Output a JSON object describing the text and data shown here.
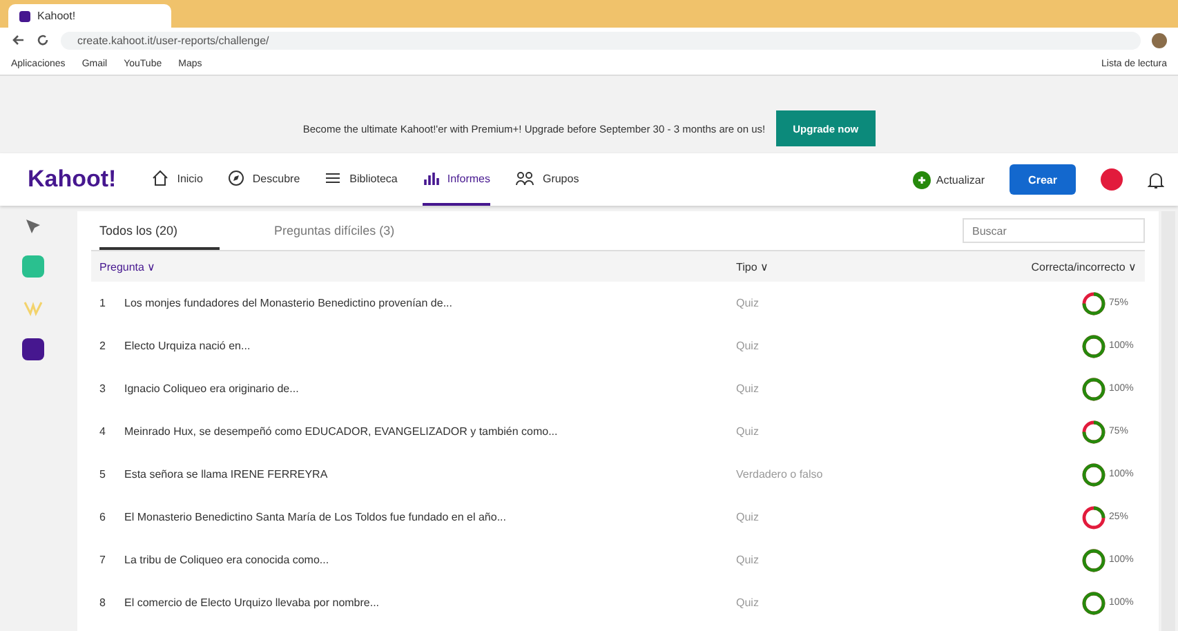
{
  "browser": {
    "tab_title": "Kahoot!",
    "url": "create.kahoot.it/user-reports/challenge/",
    "bookmarks": [
      "Aplicaciones",
      "Gmail",
      "YouTube",
      "Maps"
    ],
    "reading_list": "Lista de lectura"
  },
  "banner": {
    "text": "Become the ultimate Kahoot!'er with Premium+! Upgrade before September 30 - 3 months are on us!",
    "button": "Upgrade now"
  },
  "nav": {
    "logo": "Kahoot!",
    "items": [
      {
        "label": "Inicio",
        "selected": false
      },
      {
        "label": "Descubre",
        "selected": false
      },
      {
        "label": "Biblioteca",
        "selected": false
      },
      {
        "label": "Informes",
        "selected": true
      },
      {
        "label": "Grupos",
        "selected": false
      }
    ],
    "upgrade": "Actualizar",
    "create": "Crear"
  },
  "tabs": [
    {
      "label": "Todos los (20)",
      "selected": true
    },
    {
      "label": "Preguntas difíciles (3)",
      "selected": false
    }
  ],
  "search": {
    "placeholder": "Buscar"
  },
  "table": {
    "columns": [
      "Pregunta ∨",
      "Tipo ∨",
      "Correcta/incorrecto ∨"
    ],
    "rows": [
      {
        "number": "1",
        "question": "Los monjes fundadores del Monasterio Benedictino provenían de...",
        "type": "Quiz",
        "level": 0.75,
        "percent": "75%"
      },
      {
        "number": "2",
        "question": "Electo Urquiza nació en...",
        "type": "Quiz",
        "level": 1,
        "percent": "100%"
      },
      {
        "number": "3",
        "question": "Ignacio Coliqueo era originario de...",
        "type": "Quiz",
        "level": 1,
        "percent": "100%"
      },
      {
        "number": "4",
        "question": "Meinrado Hux, se desempeñó como EDUCADOR, EVANGELIZADOR y también como...",
        "type": "Quiz",
        "level": 0.75,
        "percent": "75%"
      },
      {
        "number": "5",
        "question": "Esta señora se llama IRENE FERREYRA",
        "type": "Verdadero o falso",
        "level": 1,
        "percent": "100%"
      },
      {
        "number": "6",
        "question": "El Monasterio Benedictino Santa María de Los Toldos fue fundado en el año...",
        "type": "Quiz",
        "level": 0.25,
        "percent": "25%"
      },
      {
        "number": "7",
        "question": "La tribu de Coliqueo era conocida como...",
        "type": "Quiz",
        "level": 1,
        "percent": "100%"
      },
      {
        "number": "8",
        "question": "El comercio de Electo Urquizo llevaba por nombre...",
        "type": "Quiz",
        "level": 1,
        "percent": "100%"
      }
    ]
  }
}
